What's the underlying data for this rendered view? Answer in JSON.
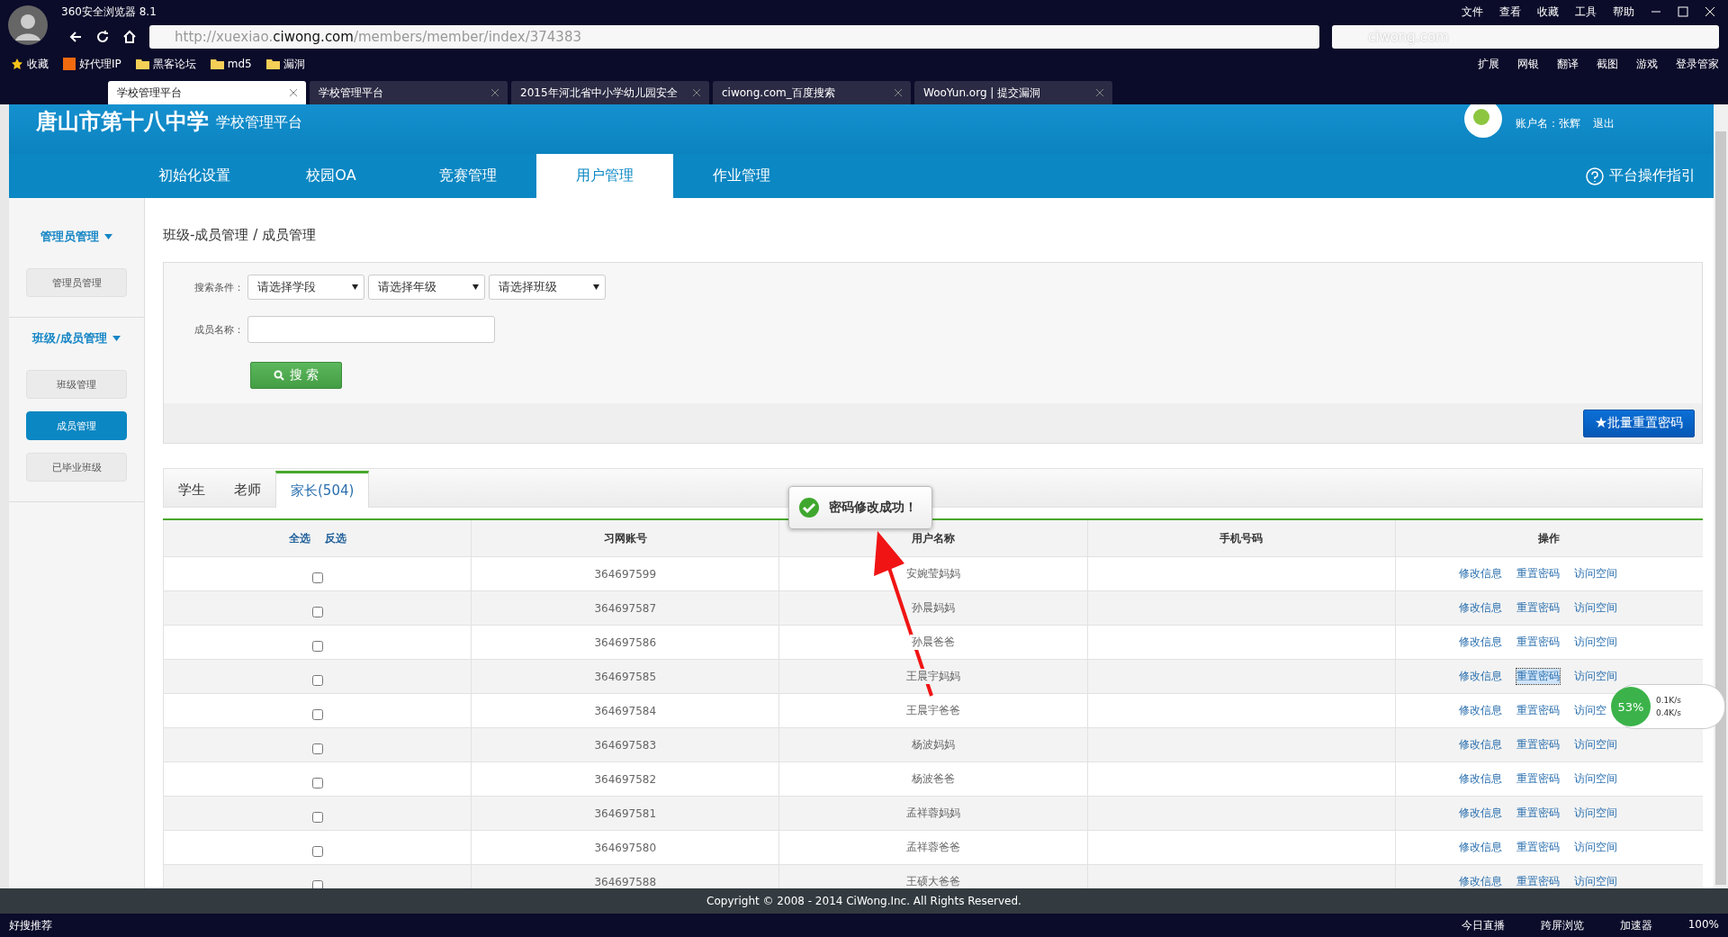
{
  "browser": {
    "title": "360安全浏览器 8.1",
    "menu": [
      "文件",
      "查看",
      "收藏",
      "工具",
      "帮助"
    ],
    "url": {
      "prefix": "http://xuexiao.",
      "domain": "ciwong.com",
      "path": "/members/member/index/374383"
    },
    "search_text": "ciwong.com",
    "bookmarks": [
      {
        "label": "收藏",
        "kind": "star"
      },
      {
        "label": "好代理IP",
        "kind": "ip"
      },
      {
        "label": "黑客论坛",
        "kind": "folder"
      },
      {
        "label": "md5",
        "kind": "folder"
      },
      {
        "label": "漏洞",
        "kind": "folder"
      }
    ],
    "extensions": [
      "扩展",
      "网银",
      "翻译",
      "截图",
      "游戏",
      "登录管家"
    ],
    "tabs": [
      {
        "title": "学校管理平台",
        "selected": true
      },
      {
        "title": "学校管理平台",
        "selected": false
      },
      {
        "title": "2015年河北省中小学幼儿园安全",
        "selected": false
      },
      {
        "title": "ciwong.com_百度搜索",
        "selected": false
      },
      {
        "title": "WooYun.org | 提交漏洞",
        "selected": false
      }
    ]
  },
  "site": {
    "school": "唐山市第十八中学",
    "subtitle": "学校管理平台",
    "account": "账户名：张辉",
    "logout": "退出",
    "help": "平台操作指引",
    "nav": [
      {
        "label": "初始化设置",
        "selected": false
      },
      {
        "label": "校园OA",
        "selected": false
      },
      {
        "label": "竞赛管理",
        "selected": false
      },
      {
        "label": "用户管理",
        "selected": true
      },
      {
        "label": "作业管理",
        "selected": false
      }
    ]
  },
  "sidebar": [
    {
      "title": "管理员管理",
      "items": [
        {
          "label": "管理员管理",
          "selected": false
        }
      ]
    },
    {
      "title": "班级/成员管理",
      "items": [
        {
          "label": "班级管理",
          "selected": false
        },
        {
          "label": "成员管理",
          "selected": true
        },
        {
          "label": "已毕业班级",
          "selected": false
        }
      ]
    }
  ],
  "breadcrumb": "班级-成员管理 / 成员管理",
  "search": {
    "condition_label": "搜索条件：",
    "selects": [
      "请选择学段",
      "请选择年级",
      "请选择班级"
    ],
    "name_label": "成员名称：",
    "button": "搜 索"
  },
  "batch_button": "★批量重置密码",
  "tabs": [
    {
      "label": "学生",
      "selected": false
    },
    {
      "label": "老师",
      "selected": false
    },
    {
      "label": "家长(504)",
      "selected": true
    }
  ],
  "table": {
    "select_all": "全选",
    "invert": "反选",
    "columns": [
      "习网账号",
      "用户名称",
      "手机号码",
      "操作"
    ],
    "rows": [
      {
        "checked": false,
        "account": "364697599",
        "name": "安婉莹妈妈",
        "actions": [
          {
            "label": "修改信息",
            "focused": false
          },
          {
            "label": "重置密码",
            "focused": false
          },
          {
            "label": "访问空间",
            "focused": false
          }
        ]
      },
      {
        "checked": false,
        "account": "364697587",
        "name": "孙晨妈妈",
        "actions": [
          {
            "label": "修改信息",
            "focused": false
          },
          {
            "label": "重置密码",
            "focused": false
          },
          {
            "label": "访问空间",
            "focused": false
          }
        ]
      },
      {
        "checked": false,
        "account": "364697586",
        "name": "孙晨爸爸",
        "actions": [
          {
            "label": "修改信息",
            "focused": false
          },
          {
            "label": "重置密码",
            "focused": false
          },
          {
            "label": "访问空间",
            "focused": false
          }
        ]
      },
      {
        "checked": false,
        "account": "364697585",
        "name": "王晨宇妈妈",
        "actions": [
          {
            "label": "修改信息",
            "focused": false
          },
          {
            "label": "重置密码",
            "focused": true
          },
          {
            "label": "访问空间",
            "focused": false
          }
        ]
      },
      {
        "checked": false,
        "account": "364697584",
        "name": "王晨宇爸爸",
        "actions": [
          {
            "label": "修改信息",
            "focused": false
          },
          {
            "label": "重置密码",
            "focused": false
          },
          {
            "label": "访问空",
            "focused": false
          }
        ]
      },
      {
        "checked": false,
        "account": "364697583",
        "name": "杨波妈妈",
        "actions": [
          {
            "label": "修改信息",
            "focused": false
          },
          {
            "label": "重置密码",
            "focused": false
          },
          {
            "label": "访问空间",
            "focused": false
          }
        ]
      },
      {
        "checked": false,
        "account": "364697582",
        "name": "杨波爸爸",
        "actions": [
          {
            "label": "修改信息",
            "focused": false
          },
          {
            "label": "重置密码",
            "focused": false
          },
          {
            "label": "访问空间",
            "focused": false
          }
        ]
      },
      {
        "checked": false,
        "account": "364697581",
        "name": "孟祥蓉妈妈",
        "actions": [
          {
            "label": "修改信息",
            "focused": false
          },
          {
            "label": "重置密码",
            "focused": false
          },
          {
            "label": "访问空间",
            "focused": false
          }
        ]
      },
      {
        "checked": false,
        "account": "364697580",
        "name": "孟祥蓉爸爸",
        "actions": [
          {
            "label": "修改信息",
            "focused": false
          },
          {
            "label": "重置密码",
            "focused": false
          },
          {
            "label": "访问空间",
            "focused": false
          }
        ]
      },
      {
        "checked": false,
        "account": "364697588",
        "name": "王硕大爸爸",
        "actions": [
          {
            "label": "修改信息",
            "focused": false
          },
          {
            "label": "重置密码",
            "focused": false
          },
          {
            "label": "访问空间",
            "focused": false
          }
        ]
      }
    ]
  },
  "toast": "密码修改成功！",
  "footer": "Copyright © 2008 - 2014 CiWong.Inc. All Rights Reserved.",
  "speed_widget": {
    "percent": "53%",
    "up": "0.1K/s",
    "down": "0.4K/s"
  },
  "status_bar": {
    "left": "好搜推荐",
    "items": [
      "今日直播",
      "跨屏浏览",
      "加速器"
    ],
    "zoom": "100%"
  }
}
